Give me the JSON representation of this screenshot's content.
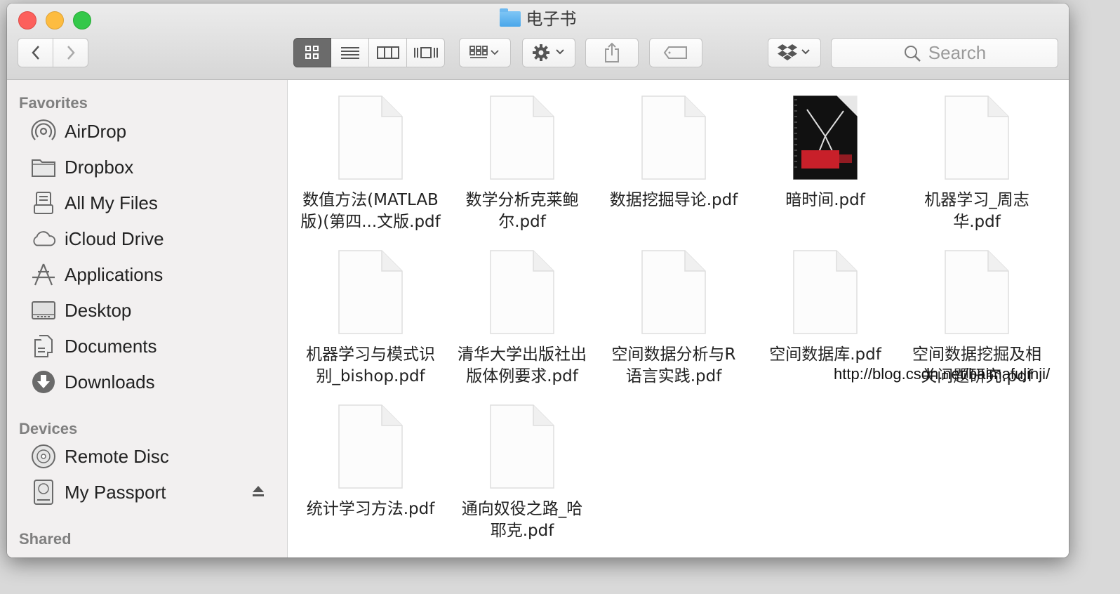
{
  "window": {
    "title": "电子书",
    "search_placeholder": "Search"
  },
  "sidebar": {
    "favorites_label": "Favorites",
    "favorites": [
      {
        "label": "AirDrop",
        "icon": "airdrop-icon"
      },
      {
        "label": "Dropbox",
        "icon": "folder-icon"
      },
      {
        "label": "All My Files",
        "icon": "all-files-icon"
      },
      {
        "label": "iCloud Drive",
        "icon": "cloud-icon"
      },
      {
        "label": "Applications",
        "icon": "applications-icon"
      },
      {
        "label": "Desktop",
        "icon": "desktop-icon"
      },
      {
        "label": "Documents",
        "icon": "documents-icon"
      },
      {
        "label": "Downloads",
        "icon": "downloads-icon"
      }
    ],
    "devices_label": "Devices",
    "devices": [
      {
        "label": "Remote Disc",
        "icon": "disc-icon"
      },
      {
        "label": "My Passport",
        "icon": "drive-icon"
      }
    ],
    "shared_label": "Shared"
  },
  "files": [
    {
      "name": "数值方法(MATLAB\n版)(第四...文版.pdf"
    },
    {
      "name": "数学分析克莱鲍\n尔.pdf"
    },
    {
      "name": "数据挖掘导论.pdf"
    },
    {
      "name": "暗时间.pdf",
      "thumbnail": true
    },
    {
      "name": "机器学习_周志\n华.pdf"
    },
    {
      "name": "机器学习与模式识\n别_bishop.pdf"
    },
    {
      "name": "清华大学出版社出\n版体例要求.pdf"
    },
    {
      "name": "空间数据分析与R\n语言实践.pdf"
    },
    {
      "name": "空间数据库.pdf"
    },
    {
      "name": "空间数据挖掘及相\n关问题研究.pdf"
    },
    {
      "name": "统计学习方法.pdf"
    },
    {
      "name": "通向奴役之路_哈\n耶克.pdf"
    }
  ],
  "watermark": "http://blog.csdn.net/baimafujinji/",
  "colors": {
    "close": "#fc605c",
    "minimize": "#fdbc40",
    "zoom": "#34c84a",
    "sidebar_bg": "#f2f0f0",
    "active_segment": "#6b6b6b"
  }
}
